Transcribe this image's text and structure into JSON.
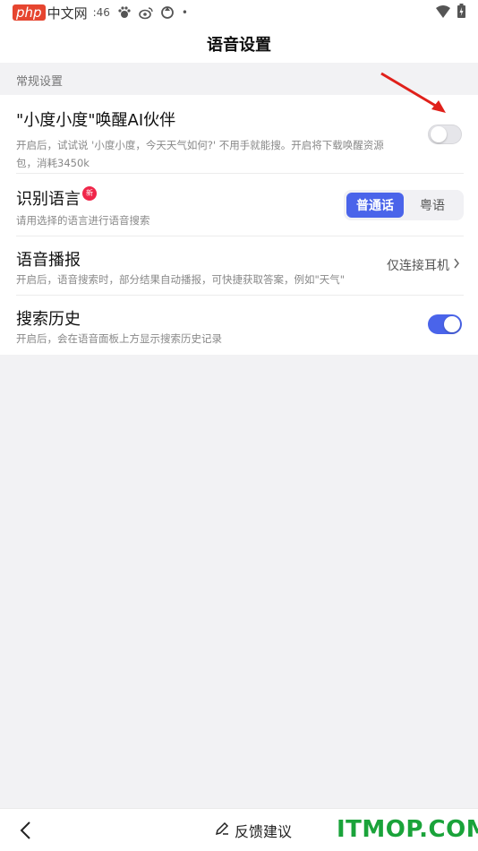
{
  "statusbar": {
    "watermark_php": "php",
    "watermark_cn": "中文网",
    "time": ":46",
    "dot": "•"
  },
  "header": {
    "title": "语音设置"
  },
  "section": {
    "label": "常规设置"
  },
  "rows": [
    {
      "title": "\"小度小度\"唤醒AI伙伴",
      "desc": "开启后，试试说 '小度小度，今天天气如何?' 不用手就能搜。开启将下载唤醒资源包，消耗3450k",
      "toggle_on": false
    },
    {
      "title": "识别语言",
      "badge": "新",
      "desc": "请用选择的语言进行语音搜索",
      "options": [
        "普通话",
        "粤语"
      ],
      "selected": "普通话"
    },
    {
      "title": "语音播报",
      "desc": "开启后，语音搜索时，部分结果自动播报，可快捷获取答案，例如\"天气\"",
      "value": "仅连接耳机"
    },
    {
      "title": "搜索历史",
      "desc": "开启后，会在语音面板上方显示搜索历史记录",
      "toggle_on": true
    }
  ],
  "bottombar": {
    "feedback_label": "反馈建议",
    "watermark": "ITMOP.COM"
  },
  "colors": {
    "accent": "#4a64ea",
    "badge": "#f0264a",
    "watermark_green": "#1aa33a",
    "arrow_red": "#e0201a"
  }
}
